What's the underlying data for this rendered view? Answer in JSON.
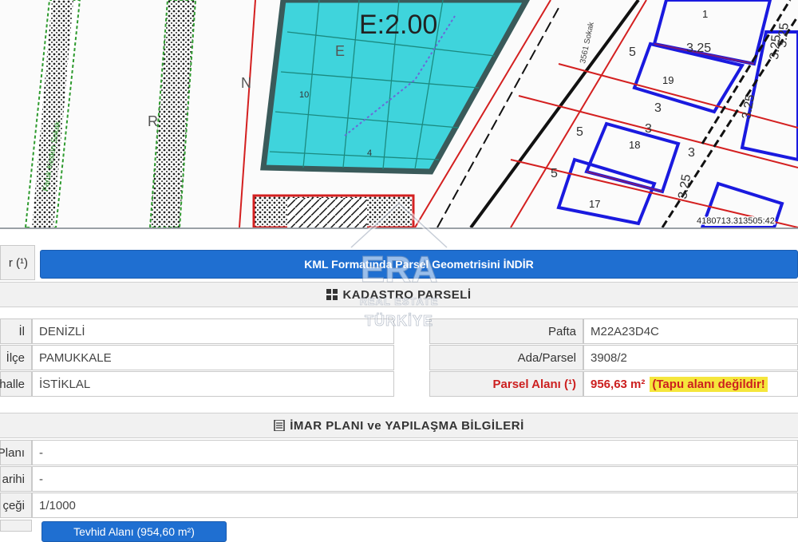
{
  "map": {
    "zone_label": "E:2.00",
    "coord_readout": "4180713.313505:42",
    "street_label_1": "Faruk Keskin Sokak",
    "street_label_2": "3561 Sokak",
    "parcel_numbers": [
      "1",
      "19",
      "18",
      "17"
    ],
    "dimension_labels": [
      "5",
      "5",
      "5",
      "3",
      "3",
      "3",
      "3.25",
      "3.25",
      "3.25",
      "3.25",
      "3.25"
    ],
    "greenarea_letters": [
      "R",
      "N",
      "E"
    ],
    "misc_labels": [
      "10",
      "4"
    ]
  },
  "watermark": {
    "brand": "ERA",
    "line2": "REAL ESTATE",
    "line3": "TÜRKİYE"
  },
  "kml_row": {
    "label": "r (¹)",
    "button_label": "KML Formatında Parsel Geometrisini İNDİR"
  },
  "kadastro": {
    "title": "KADASTRO PARSELİ",
    "left": [
      {
        "label": "İl",
        "value": "DENİZLİ"
      },
      {
        "label": "İlçe",
        "value": "PAMUKKALE"
      },
      {
        "label": "halle",
        "value": "İSTİKLAL"
      }
    ],
    "right": [
      {
        "label": "Pafta",
        "value": "M22A23D4C"
      },
      {
        "label": "Ada/Parsel",
        "value": "3908/2"
      }
    ],
    "area_label": "Parsel Alanı (¹)",
    "area_value": "956,63 m²",
    "area_note": "(Tapu alanı değildir!"
  },
  "imar": {
    "title": "İMAR PLANI ve YAPILAŞMA BİLGİLERİ",
    "rows": [
      {
        "label": "Planı",
        "value": "-"
      },
      {
        "label": "arihi",
        "value": "-"
      },
      {
        "label": "çeği",
        "value": "1/1000"
      }
    ],
    "bottom_button": "Tevhid Alanı (954,60 m²)"
  },
  "colors": {
    "accent_blue": "#1f6fd1",
    "cyan_zone": "#3fd4dc",
    "parcel_blue": "#1a1adf",
    "cadastre_red": "#d42020",
    "warning_yellow": "#f5e63c"
  }
}
